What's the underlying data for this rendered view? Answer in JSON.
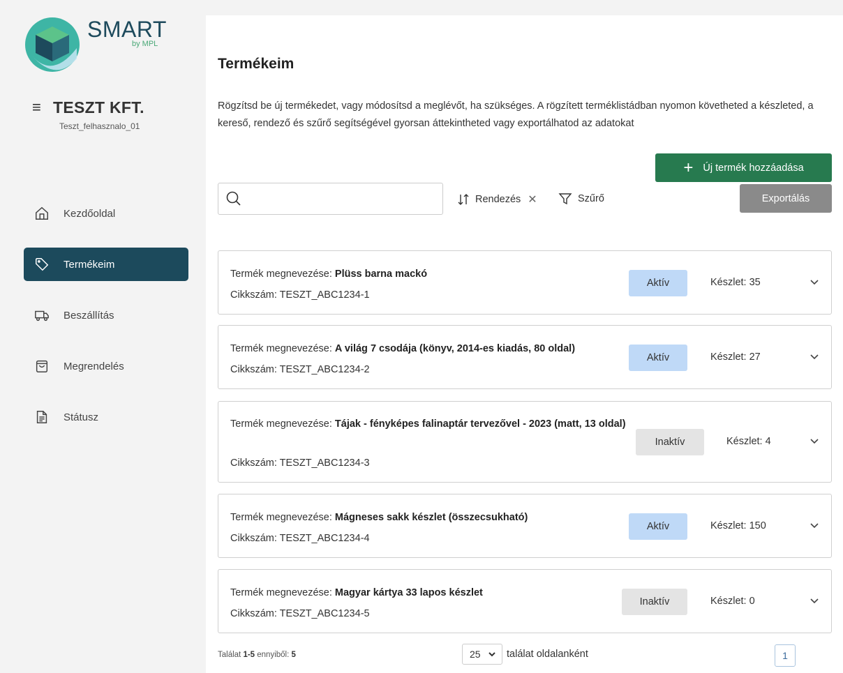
{
  "brand": {
    "name": "SMART",
    "sub": "by MPL",
    "colors": {
      "primary": "#1c4a5c",
      "green": "#277a4f"
    }
  },
  "account": {
    "company": "TESZT KFT.",
    "user": "Teszt_felhasznalo_01"
  },
  "nav": [
    {
      "label": "Kezdőoldal",
      "icon": "home-icon"
    },
    {
      "label": "Termékeim",
      "icon": "tag-icon",
      "active": true
    },
    {
      "label": "Beszállítás",
      "icon": "truck-icon"
    },
    {
      "label": "Megrendelés",
      "icon": "shopping-bag-icon"
    },
    {
      "label": "Státusz",
      "icon": "document-icon"
    }
  ],
  "page": {
    "title": "Termékeim",
    "intro": "Rögzítsd be új termékedet, vagy módosítsd a meglévőt, ha szükséges. A rögzített terméklistádban nyomon követheted a készleted, a kereső, rendező és szűrő segítségével gyorsan áttekintheted vagy exportálhatod az adatokat"
  },
  "toolbar": {
    "add_label": "Új termék hozzáadása",
    "export_label": "Exportálás",
    "search_placeholder": "",
    "sort_label": "Rendezés",
    "filter_label": "Szűrő"
  },
  "labels": {
    "name_prefix": "Termék megnevezése: ",
    "sku_prefix": "Cikkszám: ",
    "stock_prefix": "Készlet: "
  },
  "products": [
    {
      "name": "Plüss barna mackó",
      "sku": "TESZT_ABC1234-1",
      "status": "Aktív",
      "stock": "35"
    },
    {
      "name": "A világ 7 csodája (könyv, 2014-es kiadás, 80 oldal)",
      "sku": "TESZT_ABC1234-2",
      "status": "Aktív",
      "stock": "27"
    },
    {
      "name": "Tájak - fényképes falinaptár tervezővel - 2023 (matt, 13 oldal)",
      "sku": "TESZT_ABC1234-3",
      "status": "Inaktív",
      "stock": "4"
    },
    {
      "name": "Mágneses sakk készlet (összecsukható)",
      "sku": "TESZT_ABC1234-4",
      "status": "Aktív",
      "stock": "150"
    },
    {
      "name": "Magyar kártya 33 lapos készlet",
      "sku": "TESZT_ABC1234-5",
      "status": "Inaktív",
      "stock": "0"
    }
  ],
  "pagination": {
    "result_prefix": "Találat ",
    "range": "1-5",
    "of_text": " ennyiből: ",
    "total": "5",
    "per_page": "25",
    "per_page_label": "találat oldalanként",
    "current_page": "1"
  }
}
